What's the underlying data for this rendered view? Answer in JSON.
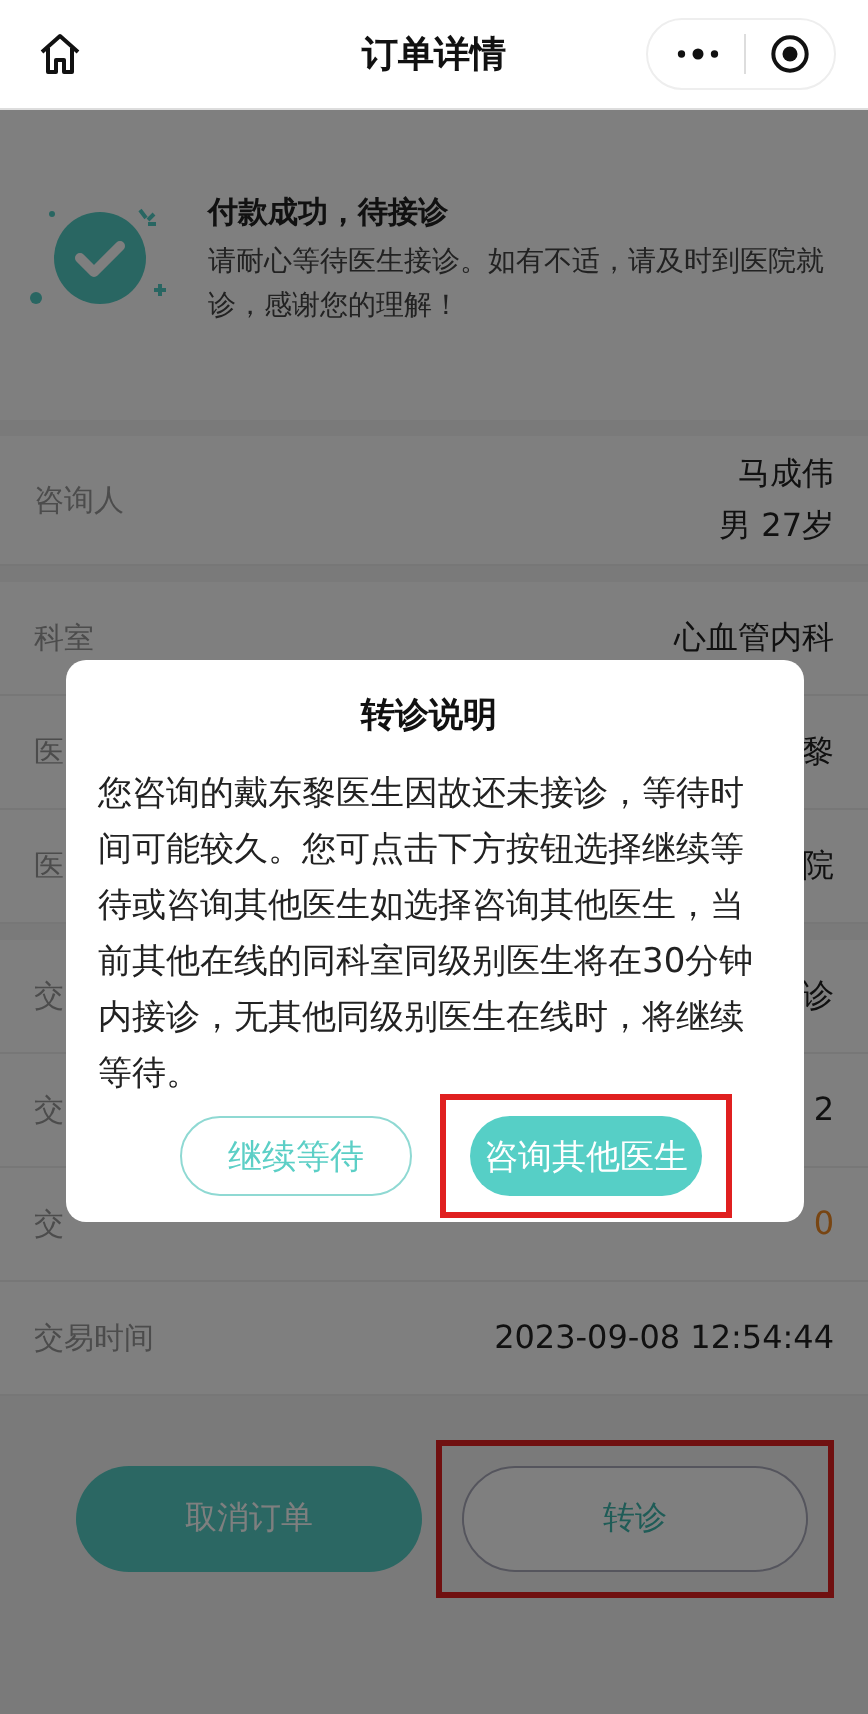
{
  "header": {
    "title": "订单详情"
  },
  "status": {
    "title": "付款成功，待接诊",
    "message": "请耐心等待医生接诊。如有不适，请及时到医院就诊，感谢您的理解！"
  },
  "sections": [
    {
      "rows": [
        {
          "label": "咨询人",
          "value": "马成伟",
          "sub_value": "男 27岁"
        }
      ]
    },
    {
      "rows": [
        {
          "label": "科室",
          "value": "心血管内科"
        },
        {
          "label": "医",
          "value": "黎"
        },
        {
          "label": "医",
          "value": "院"
        }
      ]
    },
    {
      "rows": [
        {
          "label": "交",
          "value": "诊"
        },
        {
          "label": "交",
          "value": "2"
        },
        {
          "label": "交",
          "value": "0",
          "kind": "price"
        },
        {
          "label": "交易时间",
          "value": "2023-09-08 12:54:44"
        }
      ]
    }
  ],
  "actions": [
    {
      "label": "取消订单",
      "kind": "filled",
      "highlighted": false
    },
    {
      "label": "转诊",
      "kind": "outline",
      "highlighted": true
    }
  ],
  "dialog": {
    "title": "转诊说明",
    "message": "您咨询的戴东黎医生因故还未接诊，等待时间可能较久。您可点击下方按钮选择继续等待或咨询其他医生如选择咨询其他医生，当前其他在线的同科室同级别医生将在30分钟内接诊，无其他同级别医生在线时，将继续等待。",
    "buttons": [
      {
        "label": "继续等待",
        "kind": "outline",
        "highlighted": false
      },
      {
        "label": "咨询其他医生",
        "kind": "filled",
        "highlighted": true
      }
    ]
  }
}
